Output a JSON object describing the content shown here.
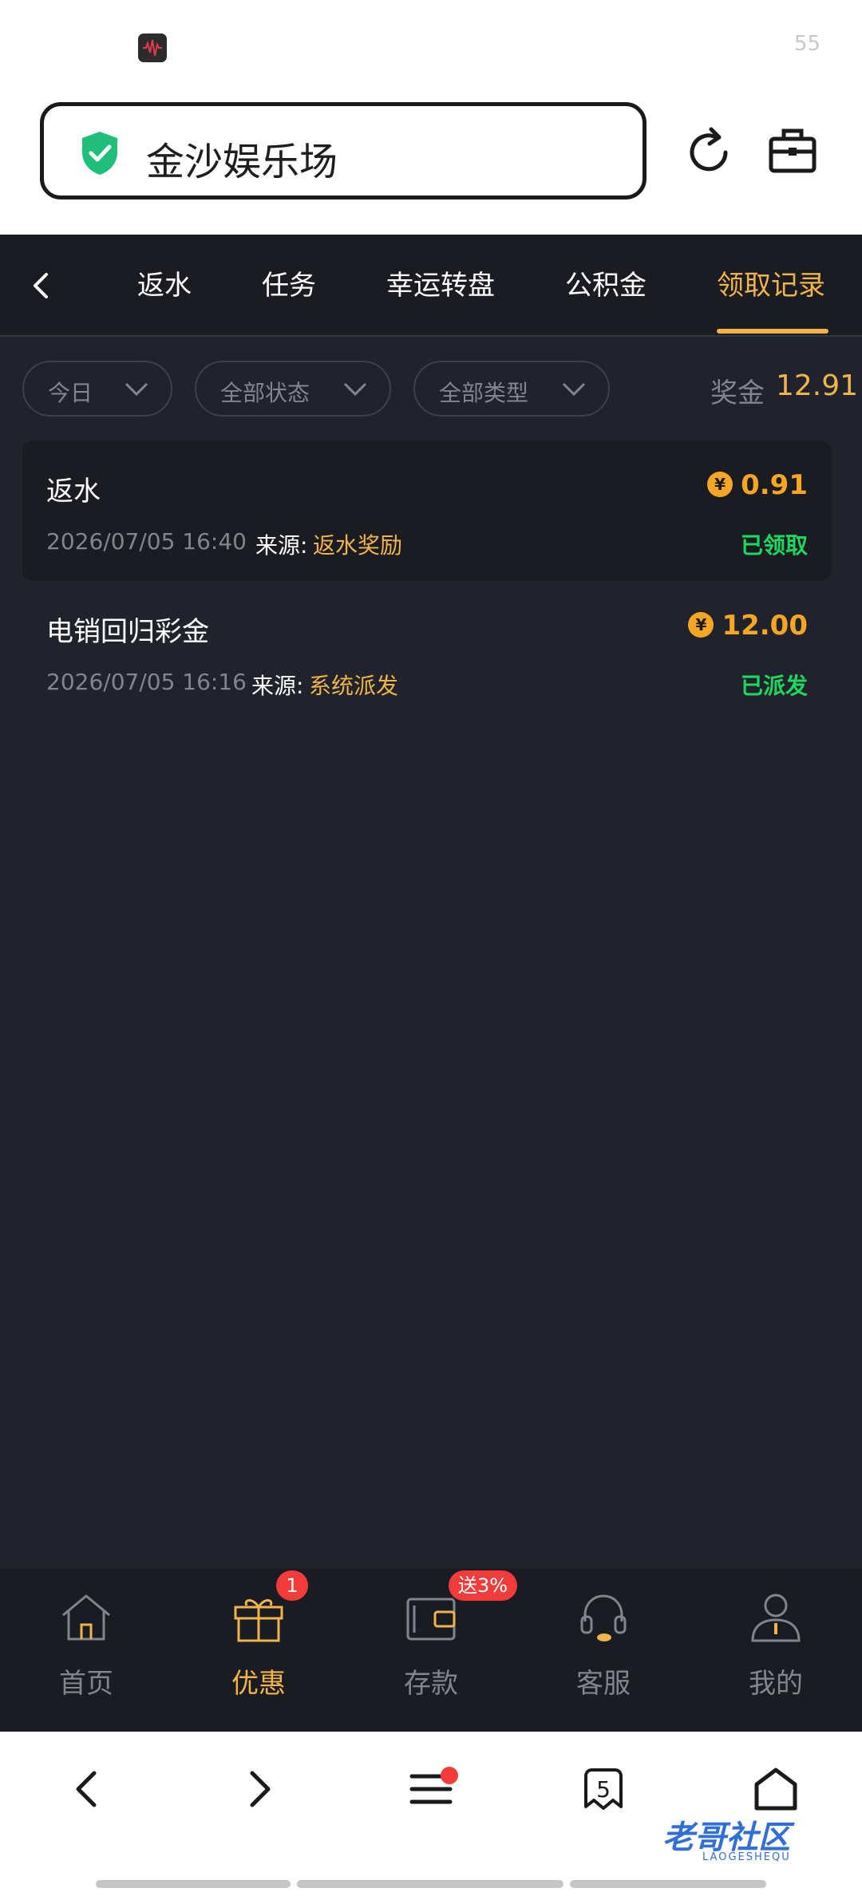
{
  "status_bar": {
    "right_text": "55"
  },
  "browser": {
    "address": "金沙娱乐场"
  },
  "nav": {
    "tabs": [
      {
        "label": "返水"
      },
      {
        "label": "任务"
      },
      {
        "label": "幸运转盘"
      },
      {
        "label": "公积金"
      },
      {
        "label": "领取记录",
        "active": true
      }
    ]
  },
  "filters": {
    "date": "今日",
    "status": "全部状态",
    "type": "全部类型",
    "bonus_label": "奖金",
    "bonus_value": "12.91"
  },
  "records": [
    {
      "title": "返水",
      "currency": "¥",
      "amount": "0.91",
      "date": "2026/07/05 16:40",
      "source_label": "来源:",
      "source": "返水奖励",
      "status": "已领取"
    },
    {
      "title": "电销回归彩金",
      "currency": "¥",
      "amount": "12.00",
      "date": "2026/07/05 16:16",
      "source_label": "来源:",
      "source": "系统派发",
      "status": "已派发"
    }
  ],
  "bottom_tabs": [
    {
      "label": "首页",
      "icon": "home-icon"
    },
    {
      "label": "优惠",
      "icon": "gift-icon",
      "active": true,
      "badge": "1"
    },
    {
      "label": "存款",
      "icon": "wallet-icon",
      "badge": "送3%"
    },
    {
      "label": "客服",
      "icon": "headset-icon"
    },
    {
      "label": "我的",
      "icon": "user-icon"
    }
  ],
  "browser_nav": {
    "tab_count": "5"
  },
  "watermark": {
    "text": "老哥社区",
    "sub": "LAOGESHEQU"
  },
  "colors": {
    "accent": "#f1b44c",
    "coin": "#f5a623",
    "success": "#1ed760",
    "badge": "#f23b3b",
    "background": "#20232c",
    "panel": "#1a1c22"
  }
}
